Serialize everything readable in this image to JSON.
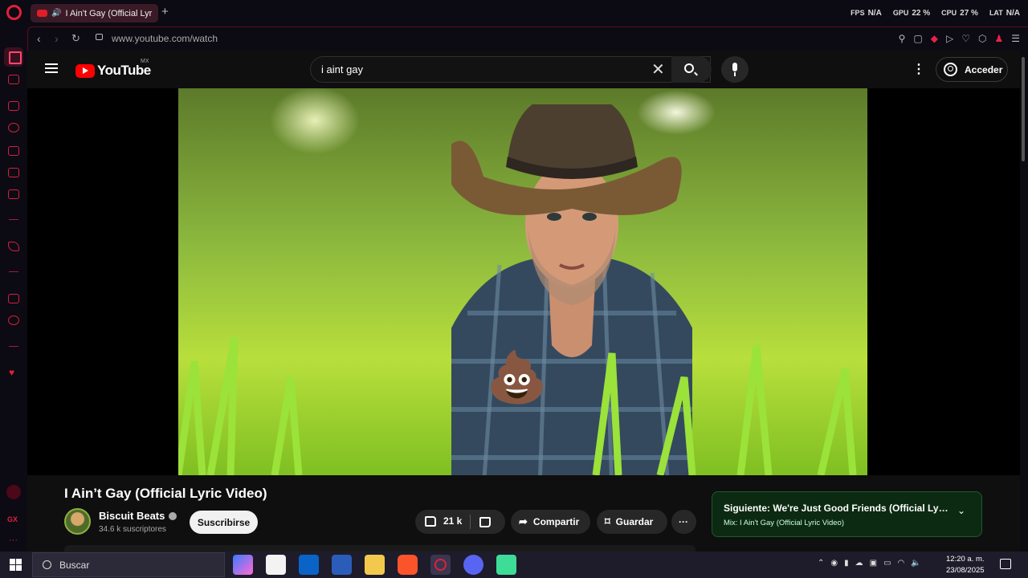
{
  "browser": {
    "tab_title": "I Ain't Gay (Official Lyr",
    "url": "www.youtube.com/watch",
    "new_tab_label": "+",
    "gx_stats": [
      {
        "label": "FPS",
        "value": "N/A"
      },
      {
        "label": "GPU",
        "value": "22 %"
      },
      {
        "label": "CPU",
        "value": "27 %"
      },
      {
        "label": "LAT",
        "value": "N/A"
      }
    ],
    "sidebar_label_gx": "GX",
    "accent_color": "#e0203a"
  },
  "youtube": {
    "logo_text": "YouTube",
    "region": "MX",
    "search_query": "i aint gay",
    "signin_label": "Acceder",
    "video": {
      "title": "I Ain’t Gay (Official Lyric Video)",
      "overlay_emoji": "💩"
    },
    "channel": {
      "name": "Biscuit Beats",
      "subscribers": "34.6 k suscriptores"
    },
    "subscribe_label": "Suscribirse",
    "likes": "21 k",
    "share_label": "Compartir",
    "save_label": "Guardar",
    "more_label": "···",
    "next": {
      "title": "Siguiente: We're Just Good Friends (Official Lyric Vi...",
      "playlist": "Mix: I Ain't Gay (Official Lyric Video)"
    }
  },
  "taskbar": {
    "search_placeholder": "Buscar",
    "time": "12:20 a. m.",
    "date": "23/08/2025"
  }
}
